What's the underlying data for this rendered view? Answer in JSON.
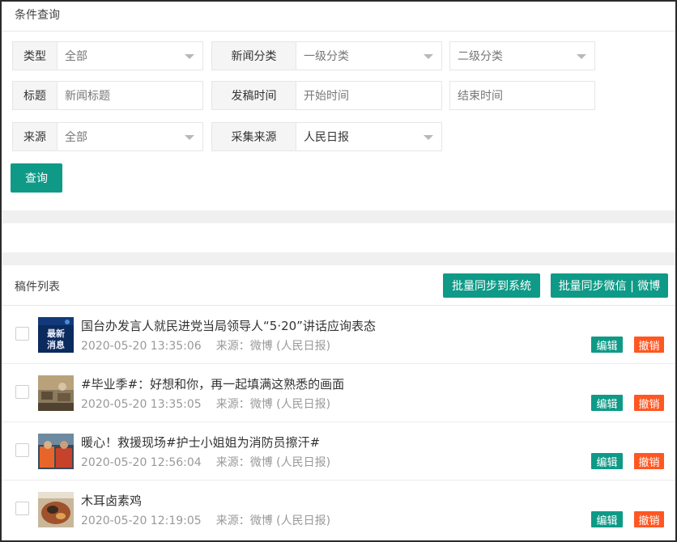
{
  "filter_panel": {
    "title": "条件查询",
    "type": {
      "label": "类型",
      "value": "全部"
    },
    "news_category": {
      "label": "新闻分类",
      "level1": "一级分类",
      "level2_placeholder": "二级分类"
    },
    "headline": {
      "label": "标题",
      "placeholder": "新闻标题"
    },
    "publish_time": {
      "label": "发稿时间",
      "start_placeholder": "开始时间",
      "end_placeholder": "结束时间"
    },
    "source": {
      "label": "来源",
      "value": "全部"
    },
    "collect_source": {
      "label": "采集来源",
      "value": "人民日报"
    },
    "query_button": "查询"
  },
  "list_panel": {
    "title": "稿件列表",
    "sync_system_button": "批量同步到系统",
    "sync_wechat_weibo_button": "批量同步微信 | 微博",
    "items": [
      {
        "headline": "国台办发言人就民进党当局领导人“5·20”讲话应询表态",
        "time": "2020-05-20 13:35:06",
        "source": "来源：微博 (人民日报)",
        "edit": "编辑",
        "revoke": "撤销",
        "thumb_text_1": "最新",
        "thumb_text_2": "消息",
        "thumb_icon": "news-thumbnail"
      },
      {
        "headline": "#毕业季#：好想和你，再一起填满这熟悉的画面",
        "time": "2020-05-20 13:35:05",
        "source": "来源：微博 (人民日报)",
        "edit": "编辑",
        "revoke": "撤销",
        "thumb_icon": "classroom-photo-thumbnail"
      },
      {
        "headline": "暖心！救援现场#护士小姐姐为消防员擦汗#",
        "time": "2020-05-20 12:56:04",
        "source": "来源：微博 (人民日报)",
        "edit": "编辑",
        "revoke": "撤销",
        "thumb_icon": "rescue-photo-thumbnail"
      },
      {
        "headline": "木耳卤素鸡",
        "time": "2020-05-20 12:19:05",
        "source": "来源：微博 (人民日报)",
        "edit": "编辑",
        "revoke": "撤销",
        "thumb_icon": "food-photo-thumbnail"
      }
    ]
  },
  "colors": {
    "accent": "#0f9a87",
    "danger": "#ff5722",
    "label_bg": "#f5f5f5"
  }
}
